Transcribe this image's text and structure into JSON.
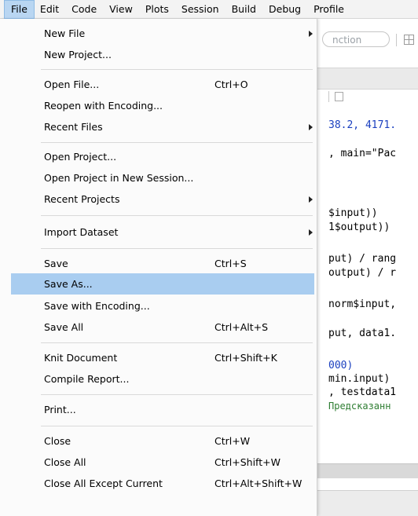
{
  "menubar": {
    "items": [
      "File",
      "Edit",
      "Code",
      "View",
      "Plots",
      "Session",
      "Build",
      "Debug",
      "Profile"
    ]
  },
  "toolbar": {
    "function_search_placeholder": "nction"
  },
  "editor": {
    "lines": [
      "38.2, 4171.",
      ", main=\"Рас",
      "$input))",
      "1$output))",
      "put) / rang",
      "output) / r",
      "norm$input,",
      "put, data1.",
      "000)",
      "min.input)",
      ", testdata1",
      "Предсказанн"
    ]
  },
  "file_menu": {
    "new_file": "New File",
    "new_project": "New Project...",
    "open_file": "Open File...",
    "open_file_shortcut": "Ctrl+O",
    "reopen_encoding": "Reopen with Encoding...",
    "recent_files": "Recent Files",
    "open_project": "Open Project...",
    "open_project_new_session": "Open Project in New Session...",
    "recent_projects": "Recent Projects",
    "import_dataset": "Import Dataset",
    "save": "Save",
    "save_shortcut": "Ctrl+S",
    "save_as": "Save As...",
    "save_encoding": "Save with Encoding...",
    "save_all": "Save All",
    "save_all_shortcut": "Ctrl+Alt+S",
    "knit_document": "Knit Document",
    "knit_shortcut": "Ctrl+Shift+K",
    "compile_report": "Compile Report...",
    "print": "Print...",
    "close": "Close",
    "close_shortcut": "Ctrl+W",
    "close_all": "Close All",
    "close_all_shortcut": "Ctrl+Shift+W",
    "close_all_except": "Close All Except Current",
    "close_all_except_shortcut": "Ctrl+Alt+Shift+W"
  }
}
